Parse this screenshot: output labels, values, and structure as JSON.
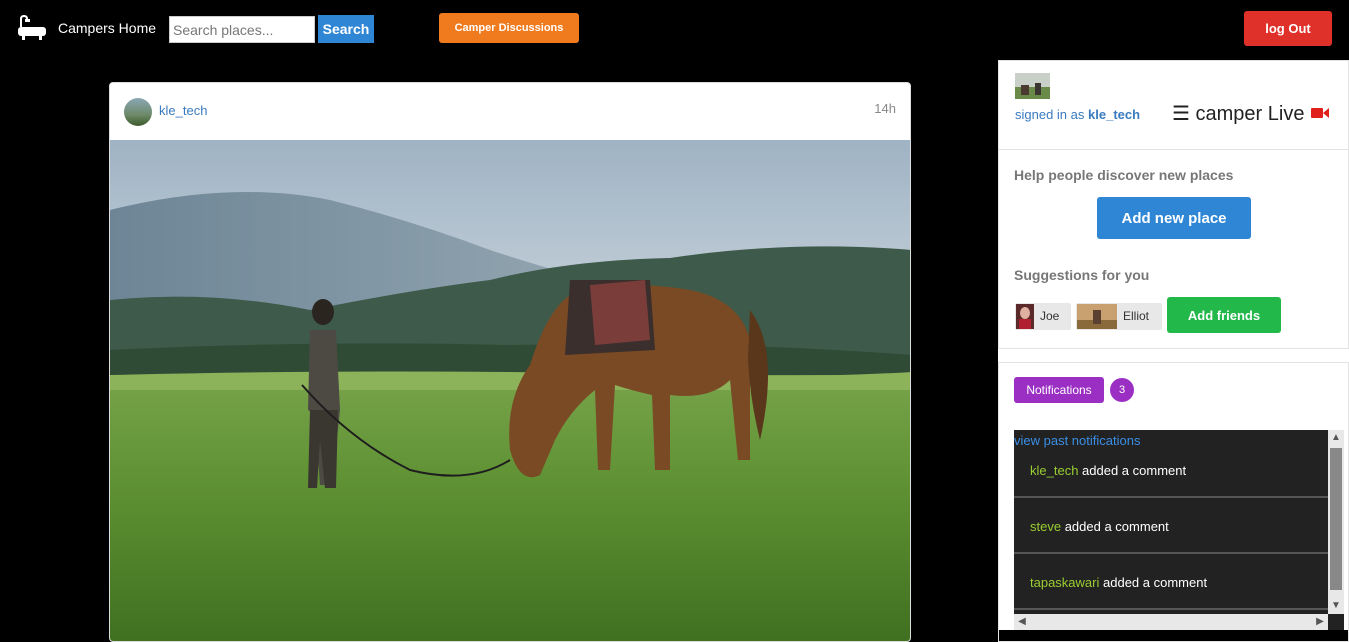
{
  "navbar": {
    "brand_icon": "bathtub-icon",
    "brand_text": "Campers Home",
    "search_placeholder": "Search places...",
    "search_label": "Search",
    "discussions_label": "Camper Discussions",
    "logout_label": "log Out",
    "colors": {
      "search": "#2e86d4",
      "discussions": "#f07a1e",
      "logout": "#e0302a"
    }
  },
  "post": {
    "username": "kle_tech",
    "time": "14h",
    "image": "photo of a boy leading a saddled brown horse grazing on a green meadow"
  },
  "sidebar": {
    "signed_in_prefix": "signed in as",
    "signed_in_user": "kle_tech",
    "live_menu_icon": "☰",
    "live_label": "camper Live",
    "live_icon": "video-camera-icon",
    "discover_title": "Help people discover new places",
    "add_place_label": "Add new place",
    "suggestions_title": "Suggestions for you",
    "suggestions": [
      {
        "name": "Joe"
      },
      {
        "name": "Elliot"
      }
    ],
    "add_friends_label": "Add friends",
    "colors": {
      "add_place": "#2e86d4",
      "add_friends": "#22b84a",
      "notifications": "#9b2fc4"
    }
  },
  "notifications": {
    "button_label": "Notifications",
    "count": "3",
    "view_past_label": "view past notifications",
    "items": [
      {
        "user": "kle_tech",
        "action": "added a comment"
      },
      {
        "user": "steve",
        "action": "added a comment"
      },
      {
        "user": "tapaskawari",
        "action": "added a comment"
      }
    ]
  }
}
